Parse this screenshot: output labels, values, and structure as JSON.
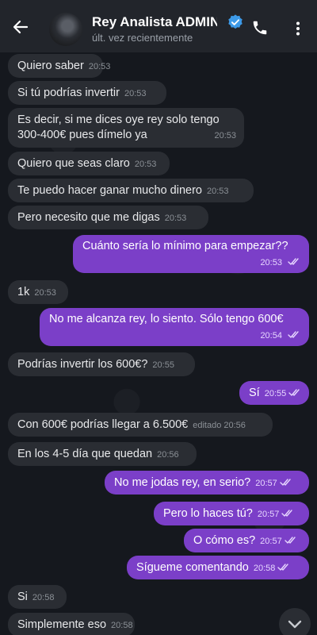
{
  "header": {
    "contact_name": "Rey Analista ADMIN",
    "status": "últ. vez recientemente"
  },
  "messages": [
    {
      "text": "Quiero saber",
      "time": "20:53",
      "dir": "in"
    },
    {
      "text": "Si tú podrías invertir",
      "time": "20:53",
      "dir": "in"
    },
    {
      "text_line1": "Es decir, si me dices oye rey solo tengo",
      "text_line2": "300-400€ pues dímelo ya",
      "time": "20:53",
      "dir": "in"
    },
    {
      "text": "Quiero que seas claro",
      "time": "20:53",
      "dir": "in"
    },
    {
      "text": "Te puedo hacer ganar mucho dinero",
      "time": "20:53",
      "dir": "in"
    },
    {
      "text": "Pero necesito que me digas",
      "time": "20:53",
      "dir": "in"
    },
    {
      "text": "Cuánto sería lo mínimo para empezar??",
      "time": "20:53",
      "dir": "out"
    },
    {
      "text": "1k",
      "time": "20:53",
      "dir": "in"
    },
    {
      "text": "No me alcanza rey, lo siento. Sólo tengo 600€",
      "time": "20:54",
      "dir": "out"
    },
    {
      "text": "Podrías invertir los 600€?",
      "time": "20:55",
      "dir": "in"
    },
    {
      "text": "Sí",
      "time": "20:55",
      "dir": "out"
    },
    {
      "text": "Con 600€ podrías llegar a 6.500€",
      "time": "editado 20:56",
      "dir": "in"
    },
    {
      "text": "En los 4-5 día que quedan",
      "time": "20:56",
      "dir": "in"
    },
    {
      "text": "No me jodas rey, en serio?",
      "time": "20:57",
      "dir": "out"
    },
    {
      "text": "Pero lo haces tú?",
      "time": "20:57",
      "dir": "out"
    },
    {
      "text": "O cómo es?",
      "time": "20:57",
      "dir": "out"
    },
    {
      "text": "Sígueme comentando",
      "time": "20:58",
      "dir": "out"
    },
    {
      "text": "Si",
      "time": "20:58",
      "dir": "in"
    },
    {
      "text": "Simplemente eso",
      "time": "20:58",
      "dir": "in"
    }
  ],
  "colors": {
    "outgoing_bubble": "#7b3fc8",
    "incoming_bubble": "#2a2d33",
    "verified_badge": "#3d9ae8"
  },
  "icons": [
    "back-arrow-icon",
    "verified-icon",
    "phone-icon",
    "more-vertical-icon",
    "double-check-icon",
    "chevron-down-icon"
  ]
}
